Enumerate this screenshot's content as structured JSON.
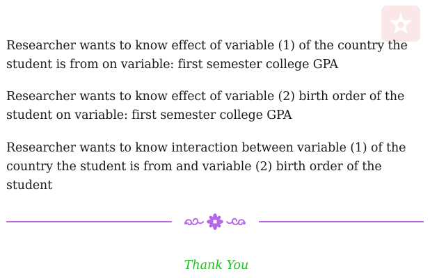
{
  "colors": {
    "divider": "#b569e6",
    "thanks": "#1fbf1f",
    "logo": "#fbe7e8"
  },
  "logo": {
    "icon": "star-emblem-icon"
  },
  "paragraphs": [
    "Researcher wants to know effect of variable (1) of the country the student is from on variable: first semester college GPA",
    "Researcher wants to know effect of variable (2) birth order of the student on variable: first semester college GPA",
    "Researcher wants to know interaction between variable (1) of the country the student is from and variable (2) birth order of the student"
  ],
  "divider": {
    "ornament": "floral-ornament-icon"
  },
  "closing": "Thank You"
}
